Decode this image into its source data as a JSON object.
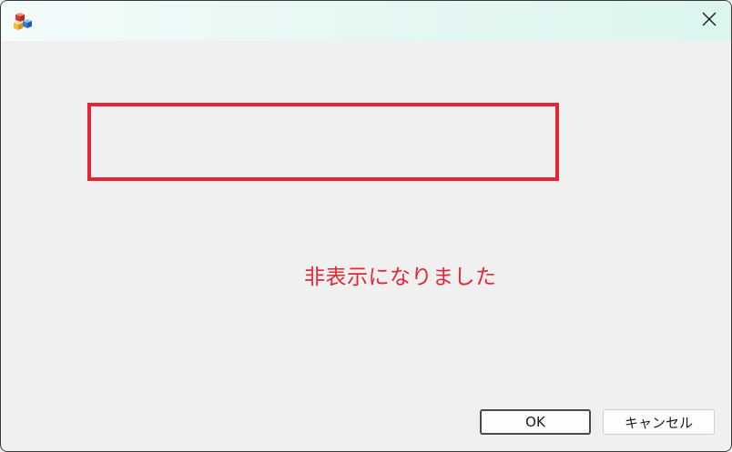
{
  "window": {
    "icon": "app-blocks-icon",
    "close_icon": "close-icon"
  },
  "message": {
    "text": "非表示になりました",
    "color": "#e32636"
  },
  "highlight_box": {
    "color": "#e32636"
  },
  "buttons": {
    "ok_label": "OK",
    "cancel_label": "キャンセル"
  }
}
